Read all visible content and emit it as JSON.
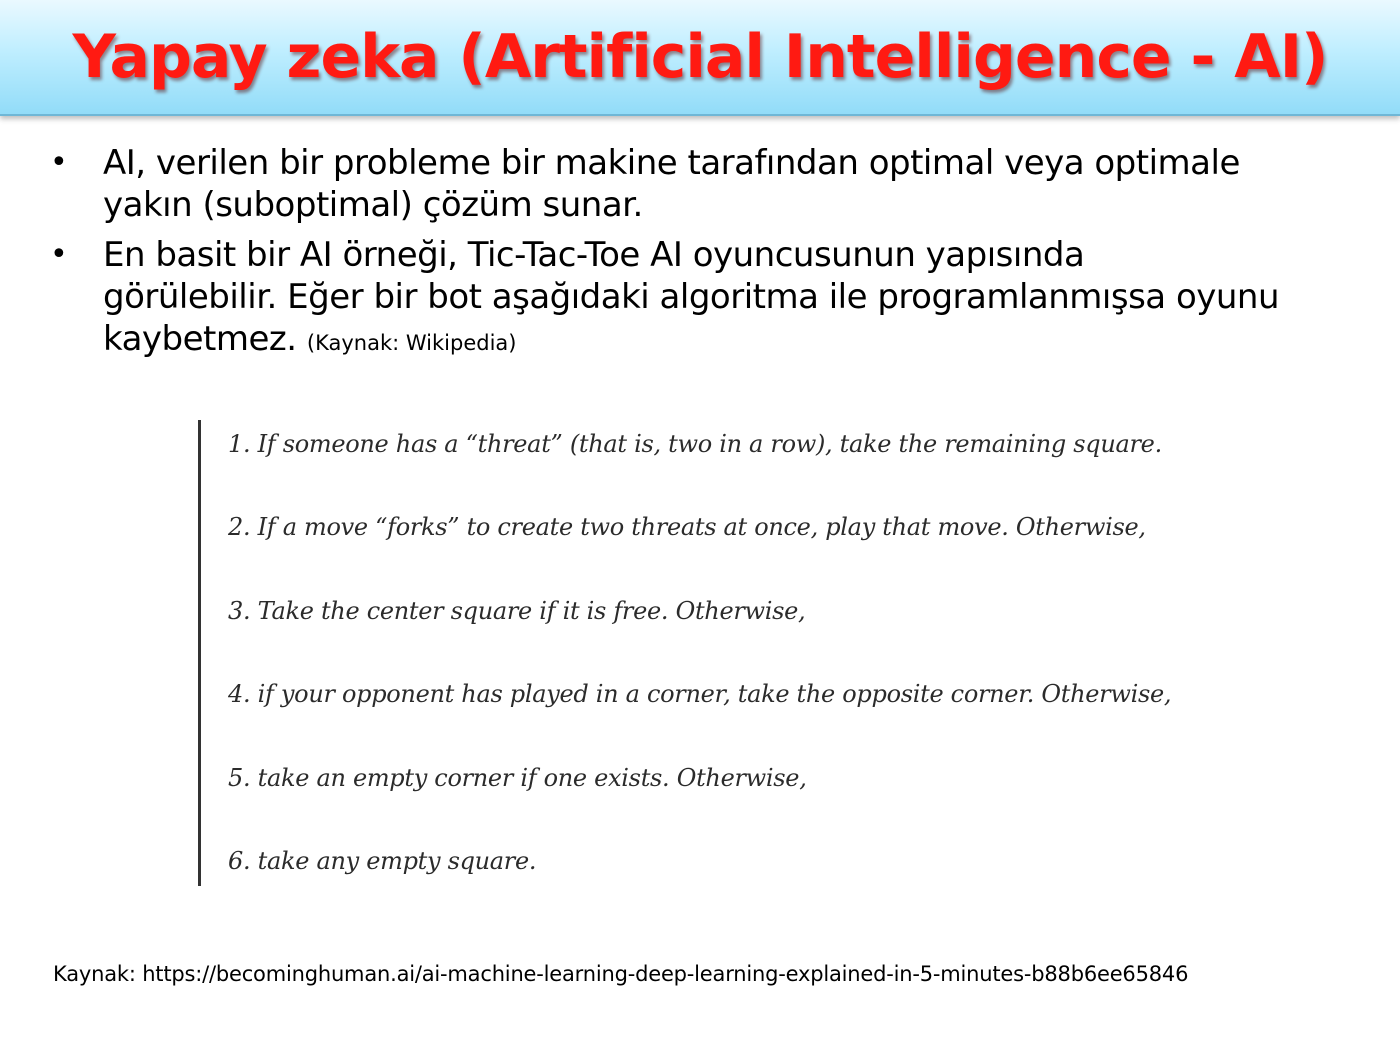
{
  "slide": {
    "title": "Yapay zeka (Artificial Intelligence - AI)"
  },
  "bullets": [
    {
      "mark": "•",
      "line1": "AI, verilen bir probleme bir makine tarafından optimal veya optimale",
      "line2": "yakın (suboptimal) çözüm sunar."
    },
    {
      "mark": "•",
      "line1": "En basit bir AI örneği, Tic-Tac-Toe AI oyuncusunun yapısında",
      "line2": "görülebilir. Eğer bir bot aşağıdaki algoritma ile programlanmışsa oyunu",
      "line3": "kaybetmez.",
      "source": "(Kaynak: Wikipedia)"
    }
  ],
  "algorithm": {
    "rules": [
      "1. If someone has a “threat” (that is, two in a row), take the remaining square.",
      "2. If a move “forks” to create two threats at once, play that move. Otherwise,",
      "3. Take the center square if it is free. Otherwise,",
      "4. if your opponent has played in a corner, take the opposite corner. Otherwise,",
      "5. take an empty corner if one exists. Otherwise,",
      "6. take any empty square."
    ]
  },
  "footer": {
    "source": "Kaynak: https://becominghuman.ai/ai-machine-learning-deep-learning-explained-in-5-minutes-b88b6ee65846"
  }
}
